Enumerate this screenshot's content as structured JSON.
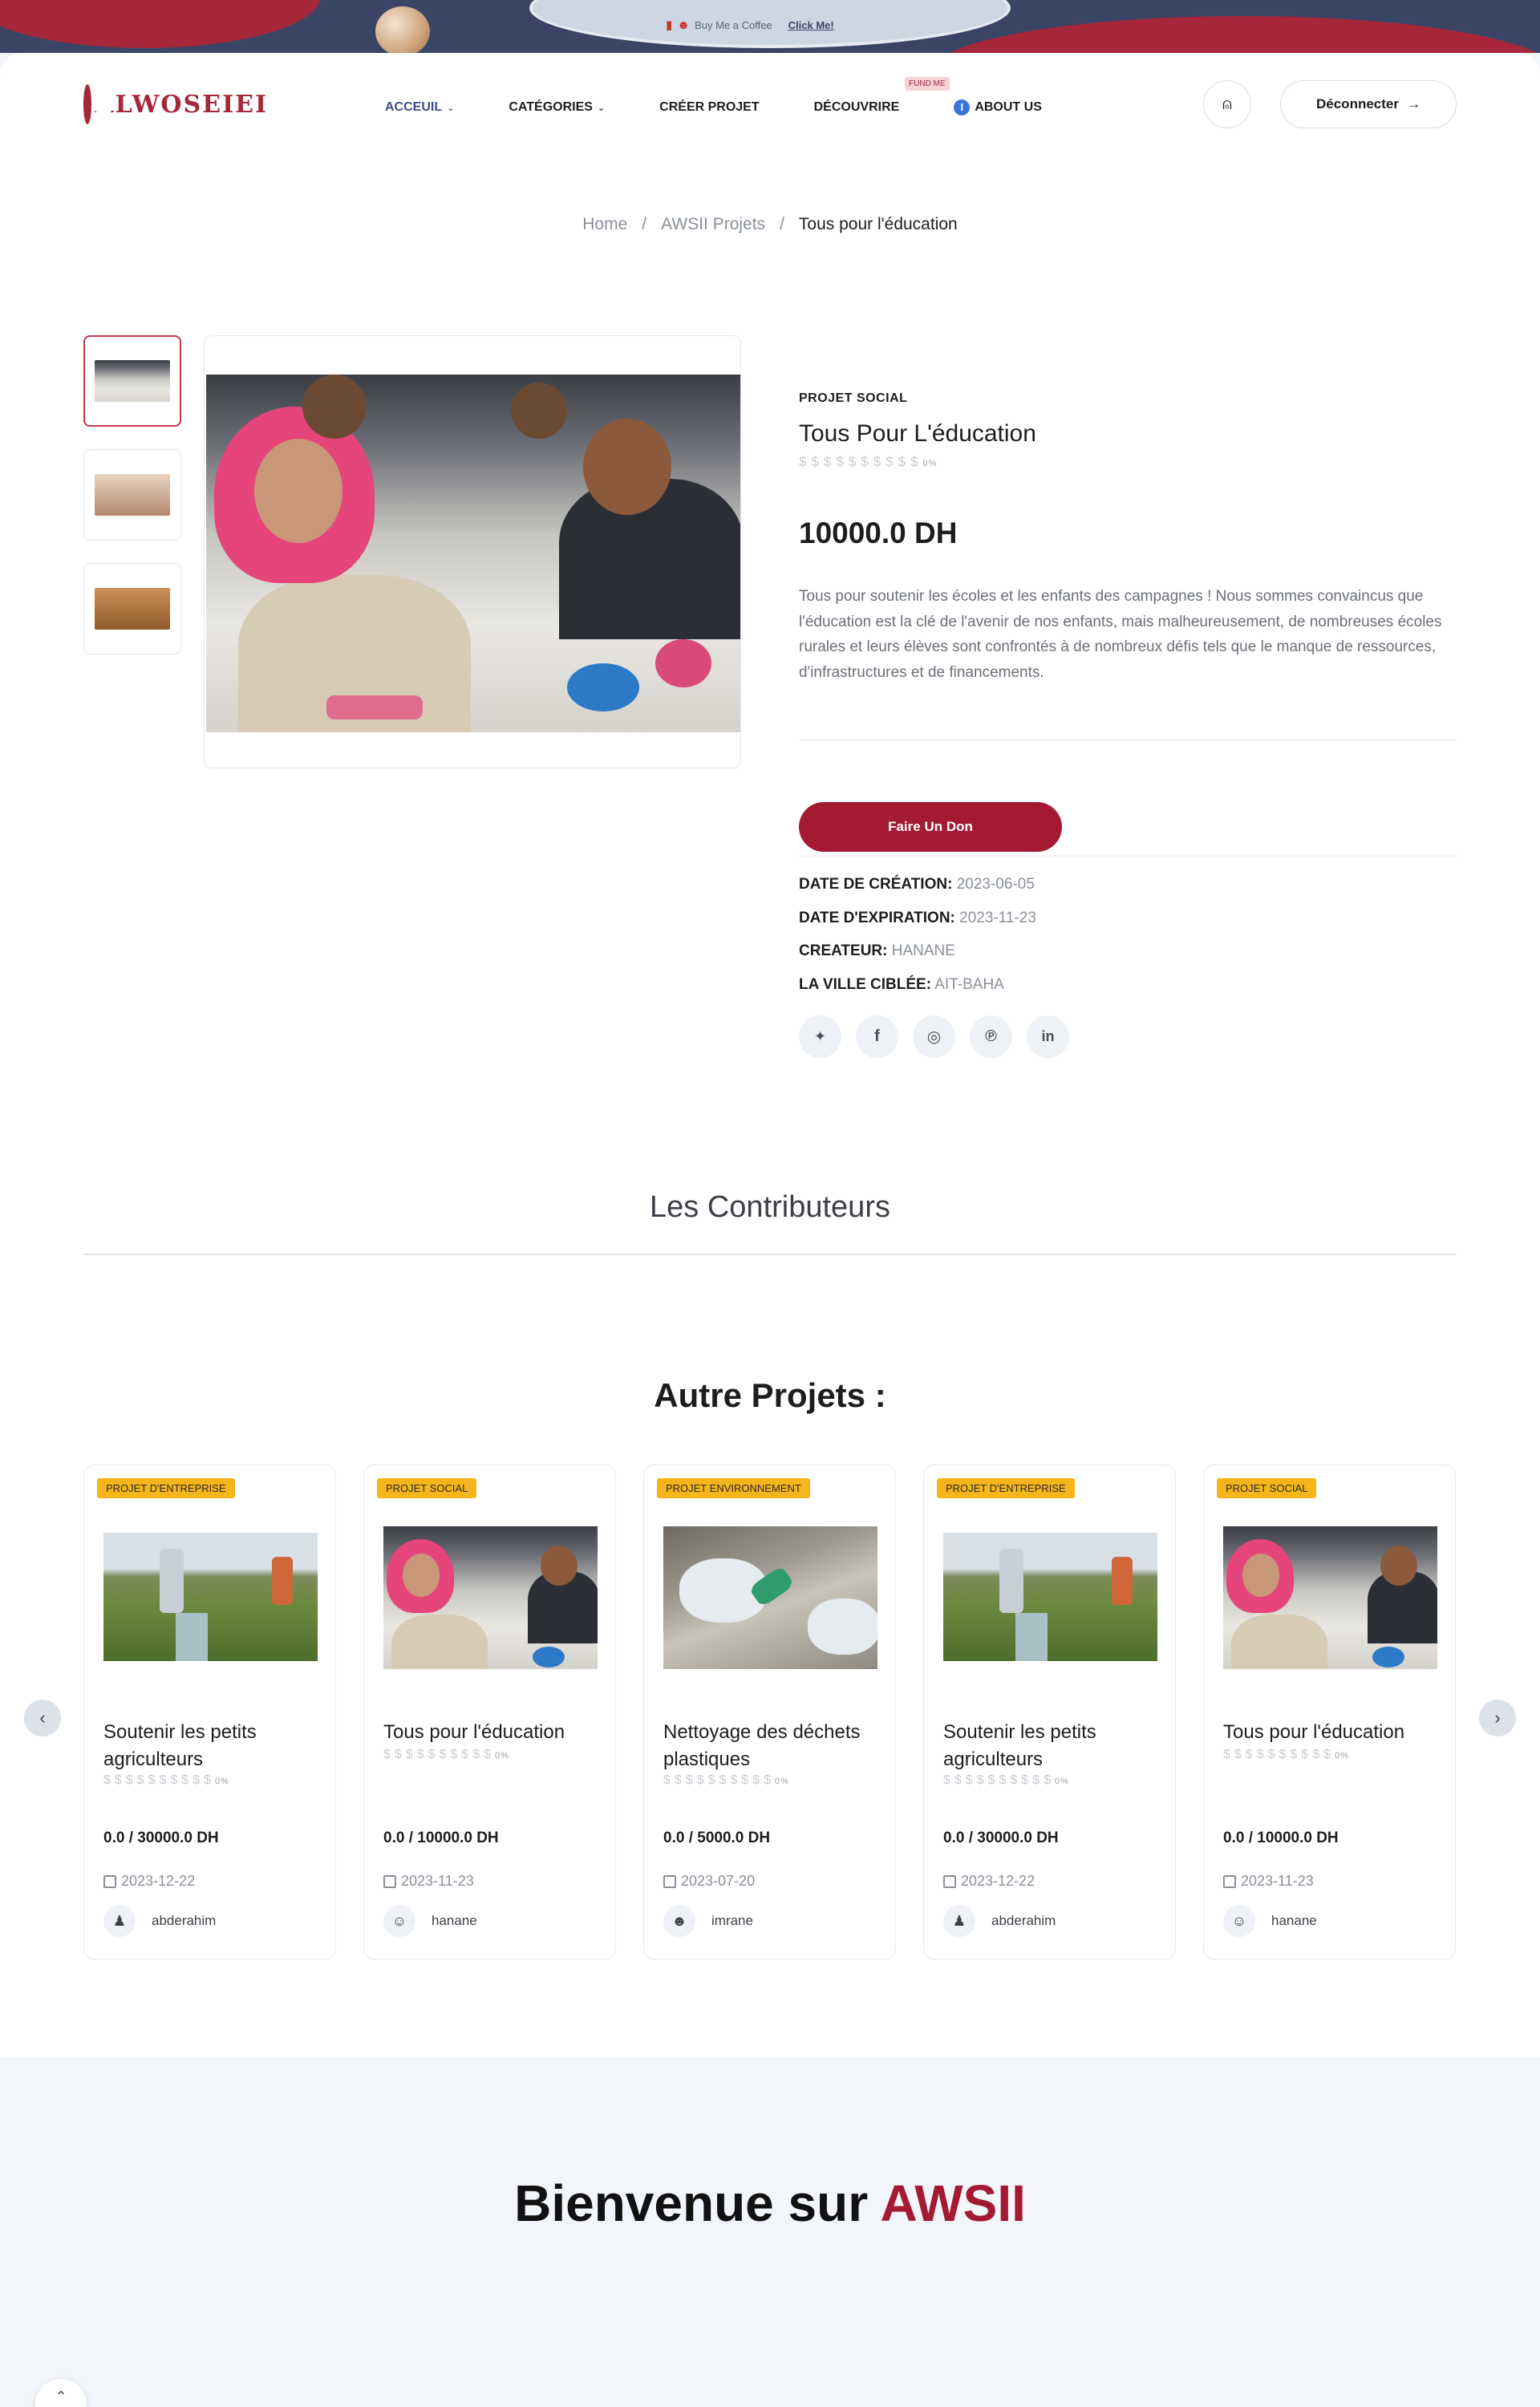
{
  "banner": {
    "text": "Buy Me a Coffee",
    "link": "Click Me!",
    "cup_icon": "coffee-cup-icon",
    "heart_icon": "heart-eyes-icon"
  },
  "brand": {
    "logo_text": "ALWOSEIEI",
    "primary_color": "#a31a32",
    "nav_accent": "#3a4f8a"
  },
  "nav": {
    "items": [
      {
        "label": "ACCEUIL",
        "dropdown": true,
        "active": true
      },
      {
        "label": "CATÉGORIES",
        "dropdown": true
      },
      {
        "label": "CRÉER PROJET"
      },
      {
        "label": "DÉCOUVRIRE",
        "badge": "FUND ME"
      },
      {
        "label": "ABOUT US",
        "icon": "info-icon"
      }
    ],
    "user_icon": "user-icon",
    "logout_label": "Déconnecter"
  },
  "breadcrumb": [
    "Home",
    "AWSII Projets",
    "Tous pour l'éducation"
  ],
  "product": {
    "category": "PROJET SOCIAL",
    "title": "Tous Pour L'éducation",
    "rating_glyphs": "$$$$$$$$$$",
    "rating_pct": "0%",
    "price": "10000.0 DH",
    "description": "Tous pour soutenir les écoles et les enfants des campagnes ! Nous sommes convaincus que l'éducation est la clé de l'avenir de nos enfants, mais malheureusement, de nombreuses écoles rurales et leurs élèves sont confrontés à de nombreux défis tels que le manque de ressources, d'infrastructures et de financements.",
    "donate_label": "Faire Un Don",
    "meta": [
      {
        "label": "DATE DE CRÉATION:",
        "value": "2023-06-05"
      },
      {
        "label": "DATE D'EXPIRATION:",
        "value": "2023-11-23"
      },
      {
        "label": "CREATEUR:",
        "value": "HANANE"
      },
      {
        "label": "LA VILLE CIBLÉE:",
        "value": "AIT-BAHA"
      }
    ],
    "socials": [
      {
        "icon": "twitter-icon",
        "glyph": "🐦"
      },
      {
        "icon": "facebook-icon",
        "glyph": "f"
      },
      {
        "icon": "instagram-icon",
        "glyph": "◎"
      },
      {
        "icon": "pinterest-icon",
        "glyph": "℗"
      },
      {
        "icon": "linkedin-icon",
        "glyph": "in"
      }
    ]
  },
  "contributors_title": "Les Contributeurs",
  "other_title": "Autre Projets :",
  "cards": [
    {
      "category": "PROJET D'ENTREPRISE",
      "title": "Soutenir les petits agriculteurs",
      "rating_pct": "0%",
      "amount": "0.0 / 30000.0 DH",
      "date": "2023-12-22",
      "author": "abderahim",
      "image": "farm"
    },
    {
      "category": "PROJET SOCIAL",
      "title": "Tous pour l'éducation",
      "rating_pct": "0%",
      "amount": "0.0 / 10000.0 DH",
      "date": "2023-11-23",
      "author": "hanane",
      "image": "edu"
    },
    {
      "category": "PROJET ENVIRONNEMENT",
      "title": "Nettoyage des déchets plastiques",
      "rating_pct": "0%",
      "amount": "0.0 / 5000.0 DH",
      "date": "2023-07-20",
      "author": "imrane",
      "image": "plastic"
    },
    {
      "category": "PROJET D'ENTREPRISE",
      "title": "Soutenir les petits agriculteurs",
      "rating_pct": "0%",
      "amount": "0.0 / 30000.0 DH",
      "date": "2023-12-22",
      "author": "abderahim",
      "image": "farm"
    },
    {
      "category": "PROJET SOCIAL",
      "title": "Tous pour l'éducation",
      "rating_pct": "0%",
      "amount": "0.0 / 10000.0 DH",
      "date": "2023-11-23",
      "author": "hanane",
      "image": "edu"
    }
  ],
  "welcome": {
    "prefix": "Bienvenue sur",
    "brand": "AWSII"
  }
}
